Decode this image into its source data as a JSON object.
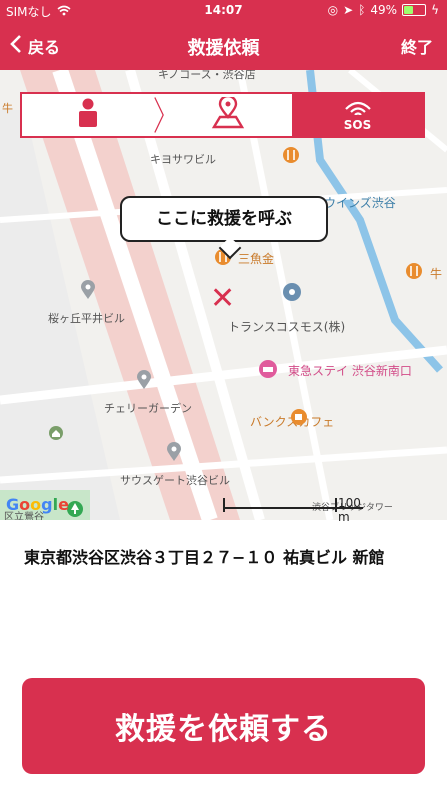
{
  "status_bar": {
    "carrier": "SIMなし",
    "time": "14:07",
    "battery_percent": "49%",
    "battery_level": 0.49
  },
  "nav": {
    "back_label": "戻る",
    "title": "救援依頼",
    "end_label": "終了"
  },
  "steps": [
    {
      "icon": "person-icon"
    },
    {
      "icon": "map-pin-icon"
    },
    {
      "icon": "sos-signal-icon",
      "label": "SOS",
      "active": true
    }
  ],
  "map": {
    "callout": "ここに救援を呼ぶ",
    "labels": {
      "kinokos": "キノコース・渋谷店",
      "ushi_left": "牛",
      "kiyosa": "キヨサワビル",
      "winds": "ウインズ渋谷",
      "sanuokin": "三魚金",
      "ushi_right": "牛",
      "sakuragaoka": "桜ヶ丘平井ビル",
      "transcosmos": "トランスコスモス(株)",
      "tokyu": "東急ステイ 渋谷新南口",
      "cherry": "チェリーガーデン",
      "banks": "バンクスカフェ",
      "southgate": "サウスゲート渋谷ビル",
      "tower": "渋谷ブリッジタワー",
      "park": "区立鶯谷"
    },
    "scale_label": "100 m",
    "provider": "Google"
  },
  "address": "東京都渋谷区渋谷３丁目２７−１０ 祐真ビル 新館",
  "cta_label": "救援を依頼する",
  "colors": {
    "brand": "#d8304f"
  }
}
